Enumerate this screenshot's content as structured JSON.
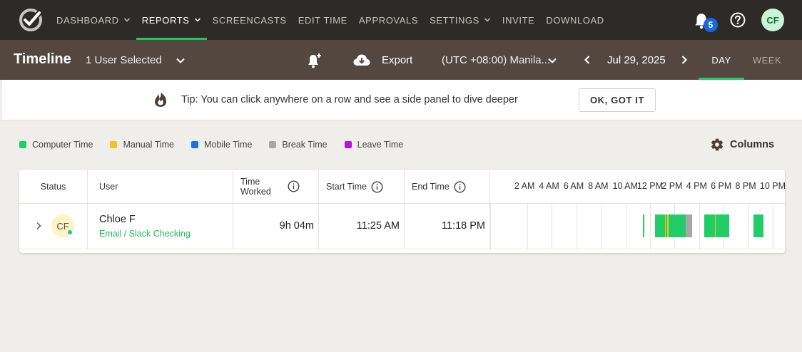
{
  "nav": {
    "items": [
      {
        "label": "DASHBOARD",
        "dropdown": true
      },
      {
        "label": "REPORTS",
        "dropdown": true,
        "active": true
      },
      {
        "label": "SCREENCASTS",
        "dropdown": false
      },
      {
        "label": "EDIT TIME",
        "dropdown": false
      },
      {
        "label": "APPROVALS",
        "dropdown": false
      },
      {
        "label": "SETTINGS",
        "dropdown": true
      },
      {
        "label": "INVITE",
        "dropdown": false
      },
      {
        "label": "DOWNLOAD",
        "dropdown": false
      }
    ],
    "notification_count": "5",
    "avatar_initials": "CF"
  },
  "toolbar": {
    "title": "Timeline",
    "user_select": "1 User Selected",
    "export_label": "Export",
    "timezone": "(UTC +08:00) Manila...",
    "date": "Jul 29, 2025",
    "tab_day": "DAY",
    "tab_week": "WEEK"
  },
  "tip": {
    "text": "Tip: You can click anywhere on a row and see a side panel to dive deeper",
    "button": "OK, GOT IT"
  },
  "legend": [
    {
      "label": "Computer Time",
      "color": "#22cc66"
    },
    {
      "label": "Manual Time",
      "color": "#ecc81c"
    },
    {
      "label": "Mobile Time",
      "color": "#1e6fe0"
    },
    {
      "label": "Break Time",
      "color": "#a9a7a5"
    },
    {
      "label": "Leave Time",
      "color": "#b514d9"
    }
  ],
  "columns_label": "Columns",
  "table": {
    "headers": {
      "status": "Status",
      "user": "User",
      "time_worked_1": "Time",
      "time_worked_2": "Worked",
      "start_time": "Start Time",
      "end_time": "End Time"
    },
    "hours": [
      "2 AM",
      "4 AM",
      "6 AM",
      "8 AM",
      "10 AM",
      "12 PM",
      "2 PM",
      "4 PM",
      "6 PM",
      "8 PM",
      "10 PM"
    ],
    "rows": [
      {
        "initials": "CF",
        "name": "Chloe F",
        "project": "Email / Slack Checking",
        "time_worked": "9h 04m",
        "start_time": "11:25 AM",
        "end_time": "11:18 PM",
        "segments": [
          {
            "type": "computer",
            "start": 11.42,
            "end": 11.5
          },
          {
            "type": "computer",
            "start": 12.4,
            "end": 13.2
          },
          {
            "type": "manual",
            "start": 13.2,
            "end": 13.27
          },
          {
            "type": "computer",
            "start": 13.27,
            "end": 13.4
          },
          {
            "type": "manual",
            "start": 13.4,
            "end": 13.5
          },
          {
            "type": "computer",
            "start": 13.5,
            "end": 14.9
          },
          {
            "type": "break",
            "start": 14.9,
            "end": 15.45
          },
          {
            "type": "computer",
            "start": 16.45,
            "end": 17.3
          },
          {
            "type": "manual",
            "start": 17.3,
            "end": 17.38
          },
          {
            "type": "computer",
            "start": 17.38,
            "end": 18.45
          },
          {
            "type": "computer",
            "start": 20.45,
            "end": 21.25
          }
        ]
      }
    ]
  }
}
